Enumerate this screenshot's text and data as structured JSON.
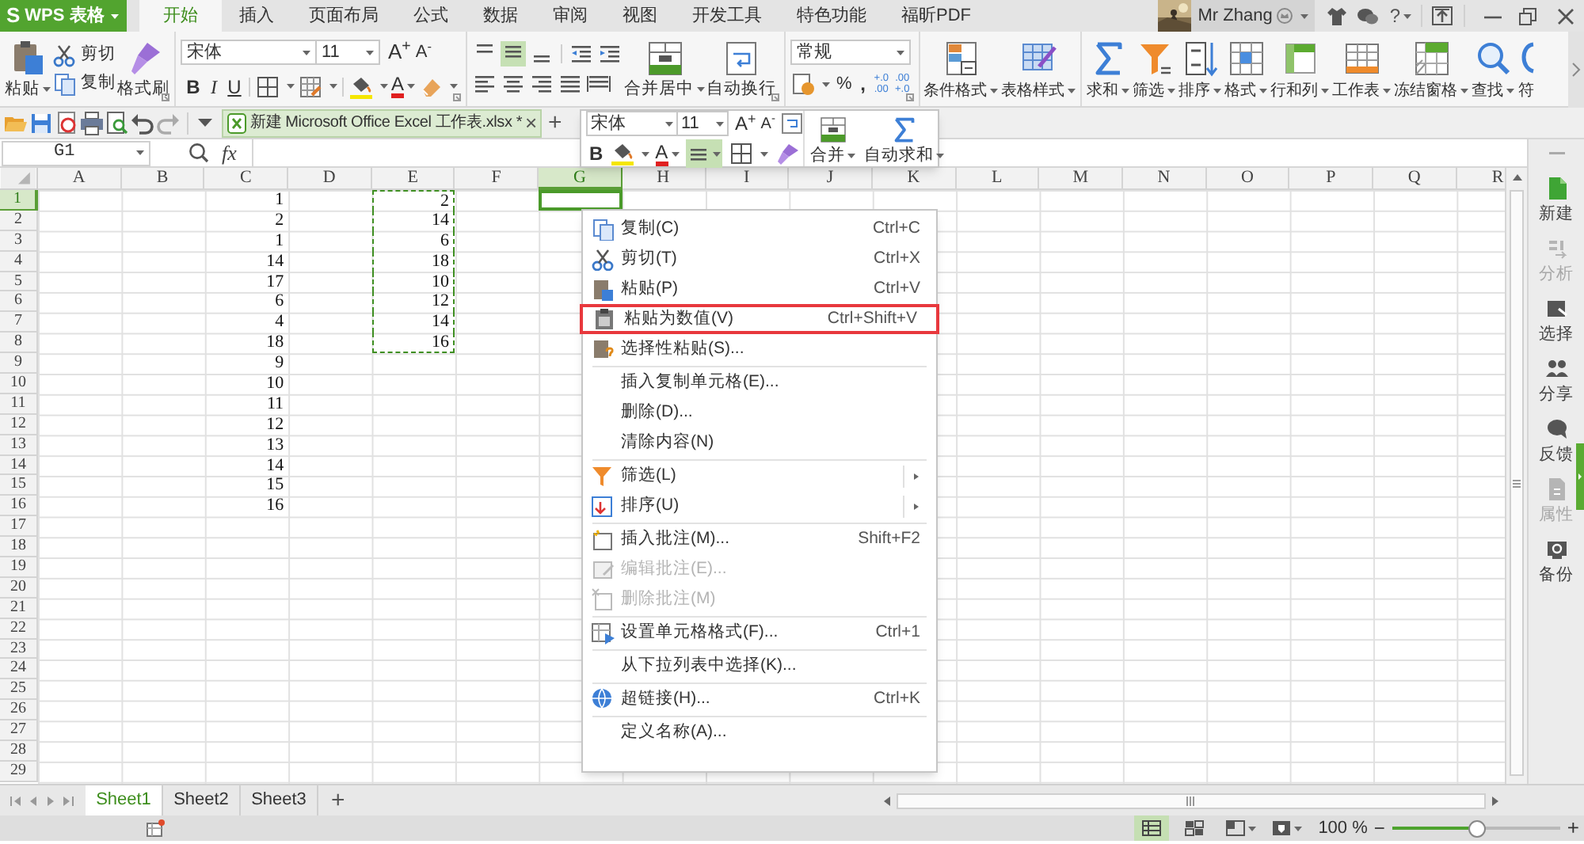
{
  "title_bar": {
    "app_logo": "S",
    "app_name": "WPS 表格",
    "tabs": [
      {
        "label": "开始",
        "selected": true
      },
      {
        "label": "插入",
        "selected": false
      },
      {
        "label": "页面布局",
        "selected": false
      },
      {
        "label": "公式",
        "selected": false
      },
      {
        "label": "数据",
        "selected": false
      },
      {
        "label": "审阅",
        "selected": false
      },
      {
        "label": "视图",
        "selected": false
      },
      {
        "label": "开发工具",
        "selected": false
      },
      {
        "label": "特色功能",
        "selected": false
      },
      {
        "label": "福昕PDF",
        "selected": false
      }
    ],
    "user_name": "Mr Zhang",
    "help": "?"
  },
  "ribbon": {
    "clipboard": {
      "paste": "粘贴",
      "cut": "剪切",
      "copy": "复制",
      "format_painter": "格式刷"
    },
    "font": {
      "name": "宋体",
      "size": "11",
      "grow_font": "A$^{+}$",
      "shrink_font": "A$^{-}$",
      "bold": "B",
      "italic": "I",
      "underline": "U",
      "font_color": "A"
    },
    "alignment": {
      "middle_align": {
        "selected": true
      },
      "merge": "合并居中",
      "wrap": "自动换行"
    },
    "number": {
      "format": "常规",
      "percent": "%",
      "comma": ",",
      "increase_decimal": {
        "top": "+.0",
        "bottom": ".00"
      },
      "decrease_decimal": {
        "top": ".00",
        "bottom": "+.0"
      }
    },
    "large_buttons": [
      {
        "label": "条件格式"
      },
      {
        "label": "表格样式"
      },
      {
        "label": "求和"
      },
      {
        "label": "筛选"
      },
      {
        "label": "排序"
      },
      {
        "label": "格式"
      },
      {
        "label": "行和列"
      },
      {
        "label": "工作表"
      },
      {
        "label": "冻结窗格"
      },
      {
        "label": "查找"
      },
      {
        "label": "符"
      }
    ]
  },
  "quick_access": {
    "document_tab": {
      "title": "新建 Microsoft Office Excel 工作表.xlsx *",
      "close": "×"
    },
    "new_tab": "+"
  },
  "formula_bar": {
    "cell_reference": "G1",
    "fx": "fx"
  },
  "mini_toolbar": {
    "font": "宋体",
    "size": "11",
    "grow_font": "A$^{+}$",
    "shrink_font": "A$^{-}$",
    "bold": "B",
    "font_color": "A",
    "align": {
      "selected": true
    },
    "merge": "合并",
    "autosum": "自动求和"
  },
  "sheet": {
    "columns": [
      {
        "label": "A",
        "selected": false
      },
      {
        "label": "B",
        "selected": false
      },
      {
        "label": "C",
        "selected": false
      },
      {
        "label": "D",
        "selected": false
      },
      {
        "label": "E",
        "selected": false
      },
      {
        "label": "F",
        "selected": false
      },
      {
        "label": "G",
        "selected": true
      },
      {
        "label": "H",
        "selected": false
      },
      {
        "label": "I",
        "selected": false
      },
      {
        "label": "J",
        "selected": false
      },
      {
        "label": "K",
        "selected": false
      },
      {
        "label": "L",
        "selected": false
      },
      {
        "label": "M",
        "selected": false
      },
      {
        "label": "N",
        "selected": false
      },
      {
        "label": "O",
        "selected": false
      },
      {
        "label": "P",
        "selected": false
      },
      {
        "label": "Q",
        "selected": false
      },
      {
        "label": "R",
        "selected": false
      }
    ],
    "rows": [
      {
        "header": "1",
        "selected": true,
        "column_c": "1",
        "column_e": "2",
        "e_copied": true
      },
      {
        "header": "2",
        "selected": false,
        "column_c": "2",
        "column_e": "14",
        "e_copied": true
      },
      {
        "header": "3",
        "selected": false,
        "column_c": "1",
        "column_e": "6",
        "e_copied": true
      },
      {
        "header": "4",
        "selected": false,
        "column_c": "14",
        "column_e": "18",
        "e_copied": true
      },
      {
        "header": "5",
        "selected": false,
        "column_c": "17",
        "column_e": "10",
        "e_copied": true
      },
      {
        "header": "6",
        "selected": false,
        "column_c": "6",
        "column_e": "12",
        "e_copied": true
      },
      {
        "header": "7",
        "selected": false,
        "column_c": "4",
        "column_e": "14",
        "e_copied": true
      },
      {
        "header": "8",
        "selected": false,
        "column_c": "18",
        "column_e": "16",
        "e_copied": true
      },
      {
        "header": "9",
        "selected": false,
        "column_c": "9",
        "e_copied": false
      },
      {
        "header": "10",
        "selected": false,
        "column_c": "10",
        "e_copied": false
      },
      {
        "header": "11",
        "selected": false,
        "column_c": "11",
        "e_copied": false
      },
      {
        "header": "12",
        "selected": false,
        "column_c": "12",
        "e_copied": false
      },
      {
        "header": "13",
        "selected": false,
        "column_c": "13",
        "e_copied": false
      },
      {
        "header": "14",
        "selected": false,
        "column_c": "14",
        "e_copied": false
      },
      {
        "header": "15",
        "selected": false,
        "column_c": "15",
        "e_copied": false
      },
      {
        "header": "16",
        "selected": false,
        "column_c": "16",
        "e_copied": false
      },
      {
        "header": "17",
        "selected": false,
        "e_copied": false
      },
      {
        "header": "18",
        "selected": false,
        "e_copied": false
      },
      {
        "header": "19",
        "selected": false,
        "e_copied": false
      },
      {
        "header": "20",
        "selected": false,
        "e_copied": false
      },
      {
        "header": "21",
        "selected": false,
        "e_copied": false
      },
      {
        "header": "22",
        "selected": false,
        "e_copied": false
      },
      {
        "header": "23",
        "selected": false,
        "e_copied": false
      },
      {
        "header": "24",
        "selected": false,
        "e_copied": false
      },
      {
        "header": "25",
        "selected": false,
        "e_copied": false
      },
      {
        "header": "26",
        "selected": false,
        "e_copied": false
      },
      {
        "header": "27",
        "selected": false,
        "e_copied": false
      },
      {
        "header": "28",
        "selected": false,
        "e_copied": false
      },
      {
        "header": "29",
        "selected": false,
        "e_copied": false
      }
    ]
  },
  "context_menu": [
    {
      "kind": "item",
      "label": "复制(C)",
      "shortcut": "Ctrl+C",
      "disabled": false,
      "highlighted": false,
      "submenu": false
    },
    {
      "kind": "item",
      "label": "剪切(T)",
      "shortcut": "Ctrl+X",
      "disabled": false,
      "highlighted": false,
      "submenu": false
    },
    {
      "kind": "item",
      "label": "粘贴(P)",
      "shortcut": "Ctrl+V",
      "disabled": false,
      "highlighted": false,
      "submenu": false
    },
    {
      "kind": "item",
      "label": "粘贴为数值(V)",
      "shortcut": "Ctrl+Shift+V",
      "disabled": false,
      "highlighted": true,
      "submenu": false
    },
    {
      "kind": "item",
      "label": "选择性粘贴(S)...",
      "disabled": false,
      "highlighted": false,
      "submenu": false
    },
    {
      "kind": "separator"
    },
    {
      "kind": "item",
      "label": "插入复制单元格(E)...",
      "disabled": false,
      "highlighted": false,
      "submenu": false
    },
    {
      "kind": "item",
      "label": "删除(D)...",
      "disabled": false,
      "highlighted": false,
      "submenu": false
    },
    {
      "kind": "item",
      "label": "清除内容(N)",
      "disabled": false,
      "highlighted": false,
      "submenu": false
    },
    {
      "kind": "separator"
    },
    {
      "kind": "item",
      "label": "筛选(L)",
      "disabled": false,
      "highlighted": false,
      "submenu": true
    },
    {
      "kind": "item",
      "label": "排序(U)",
      "disabled": false,
      "highlighted": false,
      "submenu": true
    },
    {
      "kind": "separator"
    },
    {
      "kind": "item",
      "label": "插入批注(M)...",
      "shortcut": "Shift+F2",
      "disabled": false,
      "highlighted": false,
      "submenu": false
    },
    {
      "kind": "item",
      "label": "编辑批注(E)...",
      "disabled": true,
      "highlighted": false,
      "submenu": false
    },
    {
      "kind": "item",
      "label": "删除批注(M)",
      "disabled": true,
      "highlighted": false,
      "submenu": false
    },
    {
      "kind": "separator"
    },
    {
      "kind": "item",
      "label": "设置单元格格式(F)...",
      "shortcut": "Ctrl+1",
      "disabled": false,
      "highlighted": false,
      "submenu": false
    },
    {
      "kind": "separator"
    },
    {
      "kind": "item",
      "label": "从下拉列表中选择(K)...",
      "disabled": false,
      "highlighted": false,
      "submenu": false
    },
    {
      "kind": "separator"
    },
    {
      "kind": "item",
      "label": "超链接(H)...",
      "shortcut": "Ctrl+K",
      "disabled": false,
      "highlighted": false,
      "submenu": false
    },
    {
      "kind": "separator"
    },
    {
      "kind": "item",
      "label": "定义名称(A)...",
      "disabled": false,
      "highlighted": false,
      "submenu": false
    }
  ],
  "sidebar": [
    {
      "label": "新建",
      "disabled": false
    },
    {
      "label": "分析",
      "disabled": true
    },
    {
      "label": "选择",
      "disabled": false
    },
    {
      "label": "分享",
      "disabled": false
    },
    {
      "label": "反馈",
      "disabled": false
    },
    {
      "label": "属性",
      "disabled": true
    },
    {
      "label": "备份",
      "disabled": false
    }
  ],
  "sheet_tabs": [
    {
      "label": "Sheet1",
      "selected": true
    },
    {
      "label": "Sheet2",
      "selected": false
    },
    {
      "label": "Sheet3",
      "selected": false
    }
  ],
  "add_sheet": "+",
  "status_bar": {
    "zoom": "100 %",
    "zoom_out": "−",
    "zoom_in": "+",
    "zoom_slider": {
      "level": 0.5
    }
  }
}
